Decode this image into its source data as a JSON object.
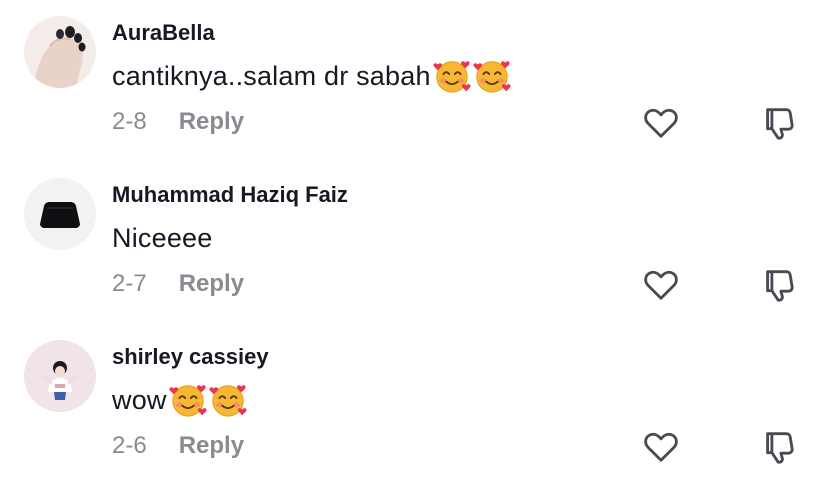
{
  "comments": [
    {
      "username": "AuraBella",
      "text": "cantiknya..salam dr sabah",
      "emojis": [
        "smiling-face-with-hearts-emoji",
        "smiling-face-with-hearts-emoji"
      ],
      "date": "2-8",
      "reply_label": "Reply",
      "avatar": "hand-nails-photo"
    },
    {
      "username": "Muhammad Haziq Faiz",
      "text": "Niceeee",
      "emojis": [],
      "date": "2-7",
      "reply_label": "Reply",
      "avatar": "dark-object-photo"
    },
    {
      "username": "shirley cassiey",
      "text": "wow",
      "emojis": [
        "smiling-face-with-hearts-emoji",
        "smiling-face-with-hearts-emoji"
      ],
      "date": "2-6",
      "reply_label": "Reply",
      "avatar": "girl-illustration-photo"
    }
  ],
  "icons": {
    "like": "heart-outline-icon",
    "dislike": "thumbs-down-outline-icon"
  },
  "colors": {
    "text": "#161823",
    "meta": "#8a8b91",
    "background": "#ffffff"
  }
}
